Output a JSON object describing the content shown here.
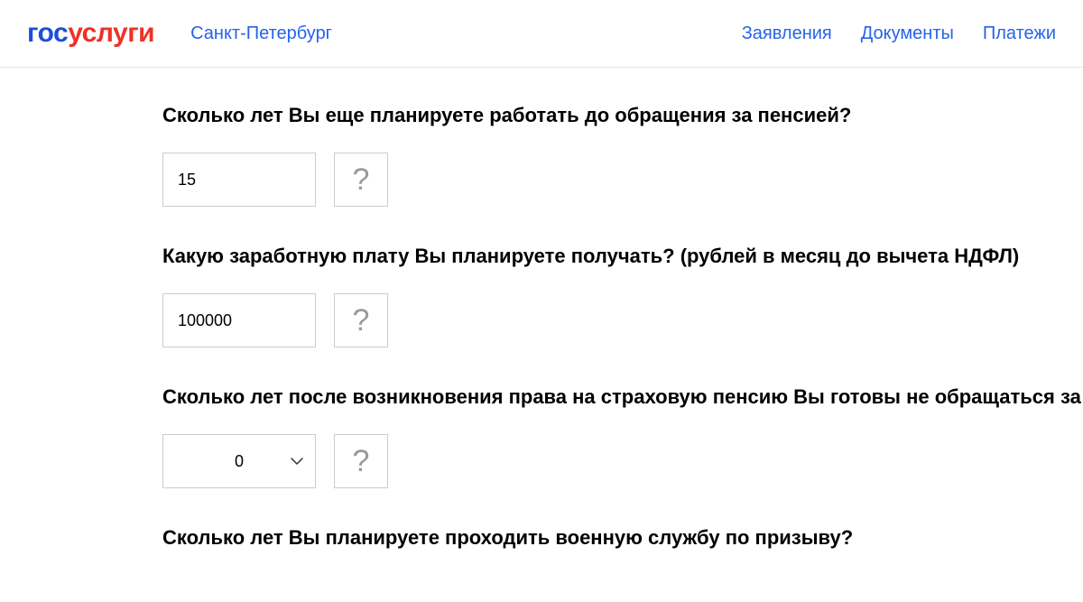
{
  "header": {
    "logo_part1": "гос",
    "logo_part2": "услуги",
    "city": "Санкт-Петербург",
    "nav": {
      "applications": "Заявления",
      "documents": "Документы",
      "payments": "Платежи"
    }
  },
  "form": {
    "help_symbol": "?",
    "q1": {
      "label": "Сколько лет Вы еще планируете работать до обращения за пенсией?",
      "value": "15"
    },
    "q2": {
      "label": "Какую заработную плату Вы планируете получать? (рублей в месяц до вычета НДФЛ)",
      "value": "100000"
    },
    "q3": {
      "label": "Сколько лет после возникновения права на страховую пенсию Вы готовы не обращаться за",
      "value": "0"
    },
    "q4": {
      "label": "Сколько лет Вы планируете проходить военную службу по призыву?"
    }
  }
}
